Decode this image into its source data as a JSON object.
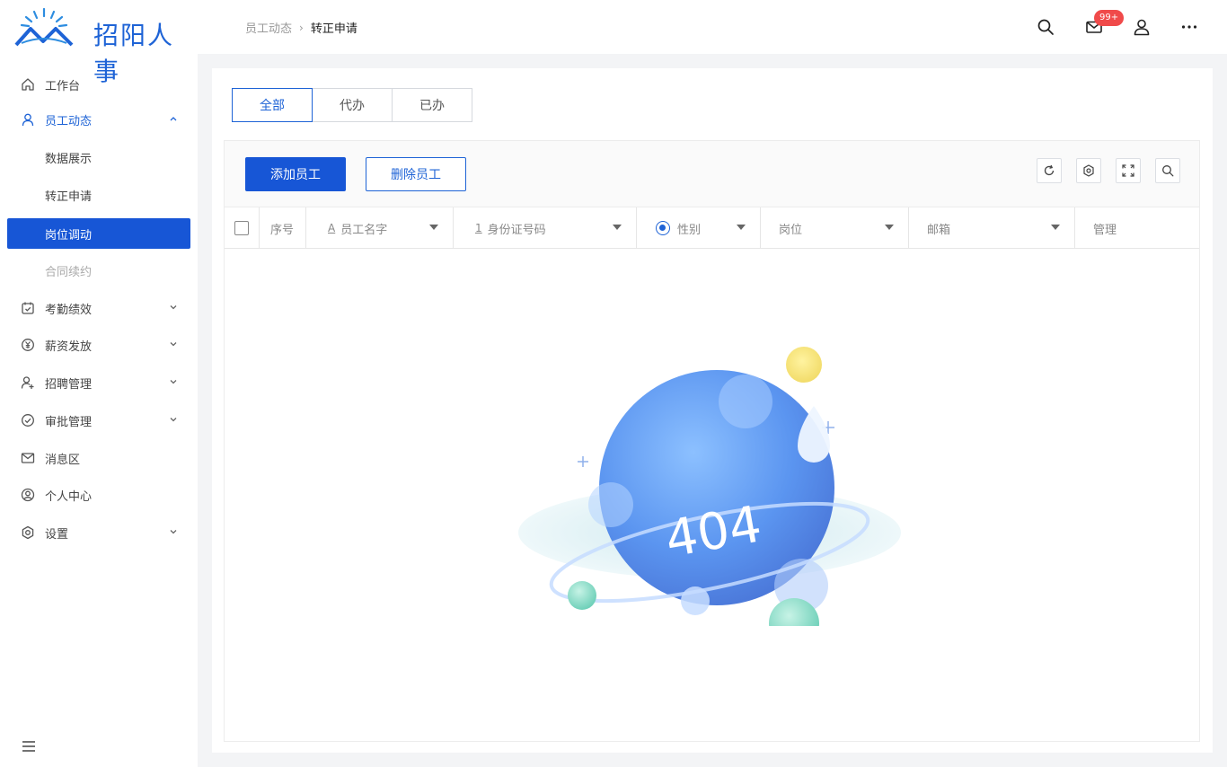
{
  "app": {
    "brand": "招阳人事",
    "accent_color": "#1756d6"
  },
  "sidebar": {
    "items": [
      {
        "label": "工作台",
        "icon": "home-icon"
      },
      {
        "label": "员工动态",
        "icon": "user-icon",
        "expanded": true,
        "children": [
          {
            "label": "数据展示"
          },
          {
            "label": "转正申请"
          },
          {
            "label": "岗位调动",
            "active": true
          },
          {
            "label": "合同续约",
            "disabled": true
          }
        ]
      },
      {
        "label": "考勤绩效",
        "icon": "calendar-check-icon"
      },
      {
        "label": "薪资发放",
        "icon": "yen-icon"
      },
      {
        "label": "招聘管理",
        "icon": "user-add-icon"
      },
      {
        "label": "审批管理",
        "icon": "check-circle-icon"
      },
      {
        "label": "消息区",
        "icon": "mail-icon"
      },
      {
        "label": "个人中心",
        "icon": "profile-icon"
      },
      {
        "label": "设置",
        "icon": "settings-icon"
      }
    ]
  },
  "header": {
    "breadcrumb": [
      "员工动态",
      "转正申请"
    ],
    "notification_badge": "99+",
    "icons": [
      "search-icon",
      "mail-icon",
      "user-icon",
      "more-icon"
    ]
  },
  "main": {
    "tabs": [
      {
        "label": "全部",
        "active": true
      },
      {
        "label": "代办"
      },
      {
        "label": "已办"
      }
    ],
    "toolbar": {
      "add_label": "添加员工",
      "delete_label": "删除员工",
      "tools": [
        "refresh-icon",
        "settings-icon",
        "fullscreen-icon",
        "search-icon"
      ]
    },
    "table": {
      "columns": [
        {
          "label": "序号"
        },
        {
          "label": "员工名字",
          "prefix": "A"
        },
        {
          "label": "身份证号码",
          "prefix": "1"
        },
        {
          "label": "性别"
        },
        {
          "label": "岗位"
        },
        {
          "label": "邮箱"
        },
        {
          "label": "管理"
        }
      ],
      "rows": []
    },
    "empty_state": {
      "text": "404"
    }
  }
}
